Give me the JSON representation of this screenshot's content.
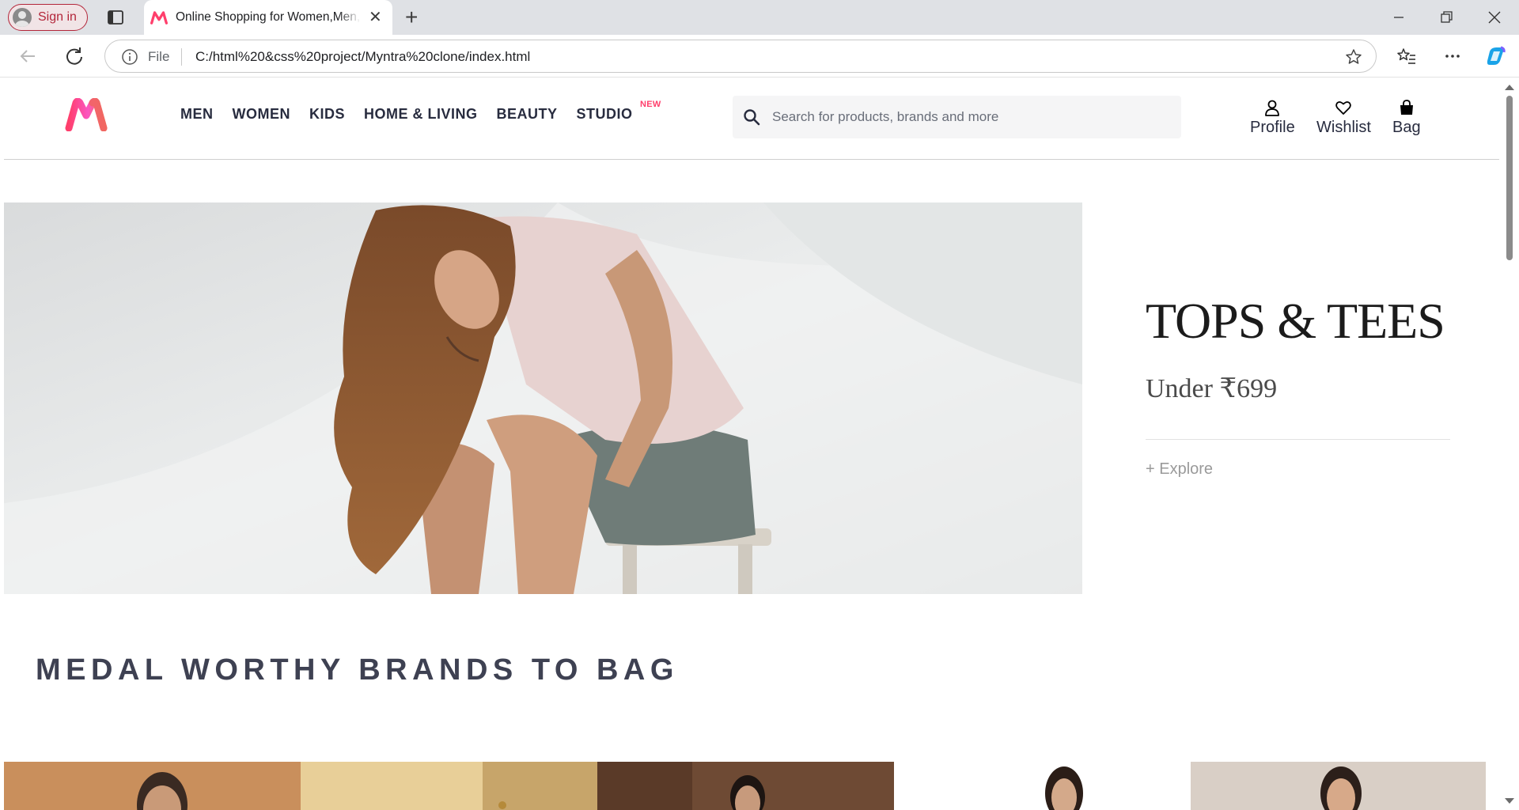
{
  "browser": {
    "signin_label": "Sign in",
    "tab_title": "Online Shopping for Women,Men,Kids",
    "file_label": "File",
    "url": "C:/html%20&css%20project/Myntra%20clone/index.html"
  },
  "header": {
    "nav": [
      {
        "label": "MEN"
      },
      {
        "label": "WOMEN"
      },
      {
        "label": "KIDS"
      },
      {
        "label": "HOME & LIVING"
      },
      {
        "label": "BEAUTY"
      },
      {
        "label": "STUDIO",
        "badge": "NEW"
      }
    ],
    "search_placeholder": "Search for products, brands and more",
    "actions": {
      "profile": "Profile",
      "wishlist": "Wishlist",
      "bag": "Bag"
    }
  },
  "hero": {
    "title": "TOPS & TEES",
    "subtitle": "Under ₹699",
    "cta": "+ Explore"
  },
  "section": {
    "title": "MEDAL WORTHY BRANDS TO BAG"
  },
  "colors": {
    "brand_pink": "#ff3f6c",
    "brand_orange": "#f16565",
    "text_dark": "#282c3f",
    "signin": "#b3263a"
  }
}
